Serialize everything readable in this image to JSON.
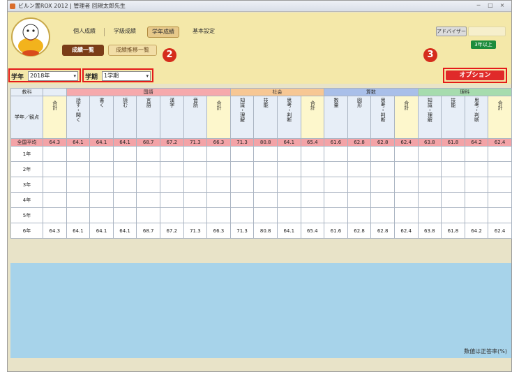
{
  "window": {
    "title": "ビルン置ROX 2012 | 管理者 回規太郎先生",
    "controls": [
      "─",
      "□",
      "×"
    ]
  },
  "nav": {
    "tabs": [
      "個人成績",
      "学級成績",
      "学年成績",
      "基本設定"
    ],
    "active_index": 2,
    "user_button": "アドバイザー",
    "green_button": "3年以上"
  },
  "subtabs": [
    "成績一覧",
    "成績推移一覧"
  ],
  "filters": {
    "grade_label": "学年",
    "grade_value": "2018年",
    "term_label": "学期",
    "term_value": "1学期"
  },
  "markers": [
    "2",
    "3"
  ],
  "option_button": "オプション",
  "table": {
    "corner_label": "教科",
    "row_header_label": "学年／観点",
    "groups": [
      {
        "name": "国語",
        "color": "#f6a9ac",
        "span": 7
      },
      {
        "name": "社会",
        "color": "#f7c794",
        "span": 4
      },
      {
        "name": "算数",
        "color": "#a9bfe9",
        "span": 4
      },
      {
        "name": "理科",
        "color": "#a6dcae",
        "span": 4
      }
    ],
    "subheaders": [
      "合計",
      "話す・聞く",
      "書く",
      "読む",
      "言語",
      "漢字",
      "音読",
      "合計",
      "知識・理解",
      "技能",
      "思考・判断",
      "合計",
      "数量",
      "図形",
      "思考・判断",
      "合計",
      "知識・理解",
      "技能",
      "思考・判断",
      "合計"
    ],
    "average_label": "全国平均",
    "average_values": [
      "64.3",
      "64.1",
      "64.1",
      "64.1",
      "68.7",
      "67.2",
      "71.3",
      "66.3",
      "71.3",
      "80.8",
      "64.1",
      "65.4",
      "61.6",
      "62.8",
      "62.8",
      "62.4",
      "63.8",
      "61.8",
      "64.2",
      "62.4"
    ],
    "rows": [
      {
        "label": "1年",
        "values": []
      },
      {
        "label": "2年",
        "values": []
      },
      {
        "label": "3年",
        "values": []
      },
      {
        "label": "4年",
        "values": []
      },
      {
        "label": "5年",
        "values": []
      },
      {
        "label": "6年",
        "values": [
          "64.3",
          "64.1",
          "64.1",
          "64.1",
          "68.7",
          "67.2",
          "71.3",
          "66.3",
          "71.3",
          "80.8",
          "64.1",
          "65.4",
          "61.6",
          "62.8",
          "62.8",
          "62.4",
          "63.8",
          "61.8",
          "64.2",
          "62.4"
        ]
      }
    ]
  },
  "footer": "数値は正答率(%)"
}
